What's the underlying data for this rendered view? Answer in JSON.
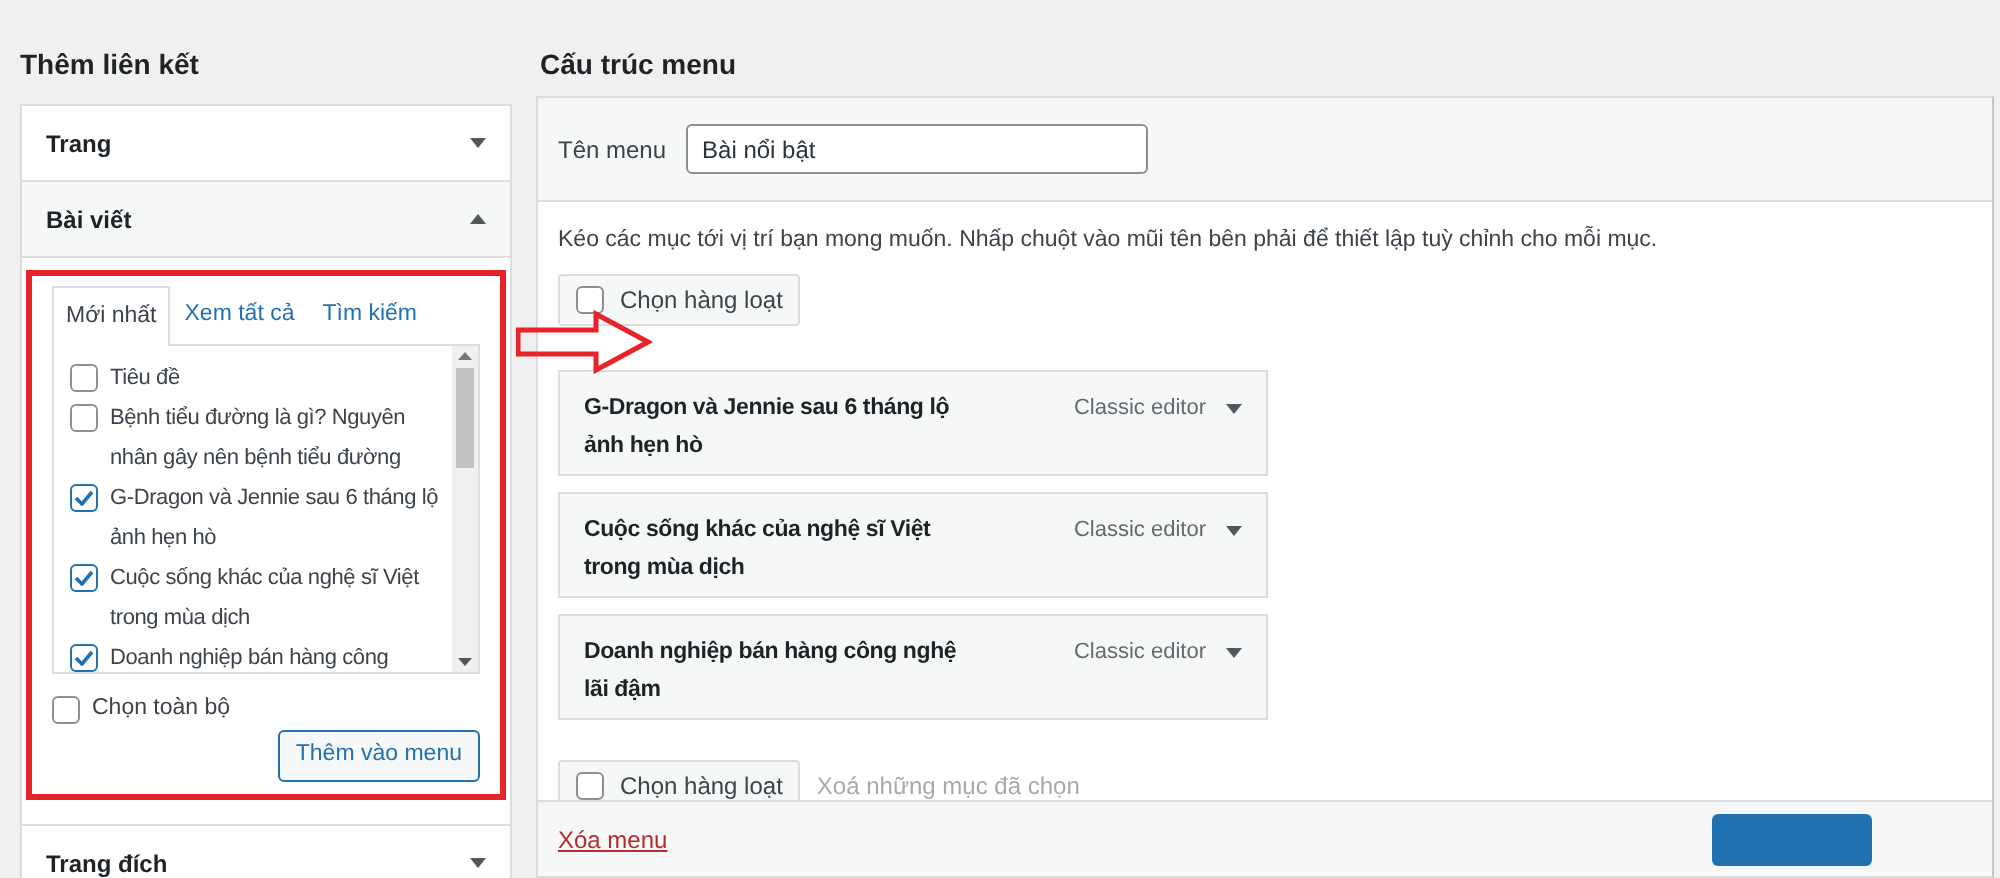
{
  "sidebar": {
    "title": "Thêm liên kết",
    "sections": [
      {
        "label": "Trang",
        "expanded": false
      },
      {
        "label": "Bài viết",
        "expanded": true,
        "tabs": [
          {
            "label": "Mới nhất",
            "selected": true
          },
          {
            "label": "Xem tất cả",
            "selected": false
          },
          {
            "label": "Tìm kiếm",
            "selected": false
          }
        ],
        "posts": [
          {
            "title": "Tiêu đề",
            "checked": false
          },
          {
            "title": "Bệnh tiểu đường là gì? Nguyên nhân gây nên bệnh tiểu đường",
            "checked": false
          },
          {
            "title": "G-Dragon và Jennie sau 6 tháng lộ ảnh hẹn hò",
            "checked": true
          },
          {
            "title": "Cuộc sống khác của nghệ sĩ Việt trong mùa dịch",
            "checked": true
          },
          {
            "title": "Doanh nghiệp bán hàng công",
            "checked": true
          }
        ],
        "select_all": {
          "label": "Chọn toàn bộ",
          "checked": false
        },
        "add_button": "Thêm vào menu"
      },
      {
        "label": "Trang đích",
        "expanded": false
      }
    ]
  },
  "menu_structure": {
    "title": "Cấu trúc menu",
    "name_label": "Tên menu",
    "name_value": "Bài nổi bật",
    "instructions": "Kéo các mục tới vị trí bạn mong muốn. Nhấp chuột vào mũi tên bên phải để thiết lập tuỳ chỉnh cho mỗi mục.",
    "bulk_select_top": {
      "label": "Chọn hàng loạt",
      "checked": false
    },
    "items": [
      {
        "title": "G-Dragon và Jennie sau 6 tháng lộ ảnh hẹn hò",
        "type": "Classic editor"
      },
      {
        "title": "Cuộc sống khác của nghệ sĩ Việt trong mùa dịch",
        "type": "Classic editor"
      },
      {
        "title": "Doanh nghiệp bán hàng công nghệ lãi đậm",
        "type": "Classic editor"
      }
    ],
    "bulk_select_bottom": {
      "label": "Chọn hàng loạt",
      "checked": false
    },
    "remove_selected": {
      "label": "Xoá những mục đã chọn",
      "disabled": true
    },
    "delete_menu": "Xóa menu"
  }
}
